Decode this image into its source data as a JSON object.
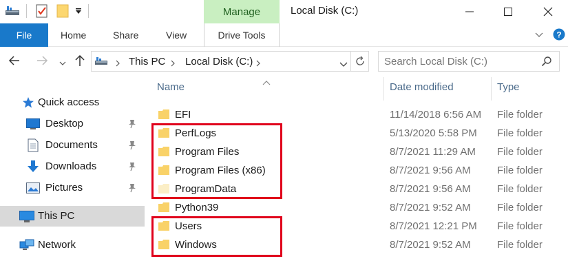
{
  "titlebar": {
    "manage_label": "Manage",
    "window_title": "Local Disk (C:)",
    "icons": [
      "drive-icon",
      "properties-icon",
      "new-folder-icon",
      "customize-qat-icon"
    ],
    "controls": [
      "minimize-icon",
      "maximize-icon",
      "close-icon"
    ]
  },
  "ribbon": {
    "file_label": "File",
    "tabs": [
      "Home",
      "Share",
      "View"
    ],
    "drive_tools_label": "Drive Tools",
    "accent": "#1979ca",
    "manage_color": "#c9efc1"
  },
  "address": {
    "segments": [
      "This PC",
      "Local Disk (C:)"
    ],
    "search_placeholder": "Search Local Disk (C:)"
  },
  "navpane": {
    "quick_access": "Quick access",
    "items": [
      {
        "label": "Desktop",
        "icon": "desktop-icon"
      },
      {
        "label": "Documents",
        "icon": "documents-icon"
      },
      {
        "label": "Downloads",
        "icon": "downloads-icon"
      },
      {
        "label": "Pictures",
        "icon": "pictures-icon"
      }
    ],
    "this_pc": "This PC",
    "network": "Network"
  },
  "filelist": {
    "columns": {
      "name": "Name",
      "date": "Date modified",
      "type": "Type"
    },
    "rows": [
      {
        "name": "EFI",
        "date": "11/14/2018 6:56 AM",
        "type": "File folder"
      },
      {
        "name": "PerfLogs",
        "date": "5/13/2020 5:58 PM",
        "type": "File folder"
      },
      {
        "name": "Program Files",
        "date": "8/7/2021 11:29 AM",
        "type": "File folder"
      },
      {
        "name": "Program Files (x86)",
        "date": "8/7/2021 9:56 AM",
        "type": "File folder"
      },
      {
        "name": "ProgramData",
        "date": "8/7/2021 9:56 AM",
        "type": "File folder"
      },
      {
        "name": "Python39",
        "date": "8/7/2021 9:52 AM",
        "type": "File folder"
      },
      {
        "name": "Users",
        "date": "8/7/2021 12:21 PM",
        "type": "File folder"
      },
      {
        "name": "Windows",
        "date": "8/7/2021 9:52 AM",
        "type": "File folder"
      }
    ],
    "highlight_color": "#e0001b"
  }
}
